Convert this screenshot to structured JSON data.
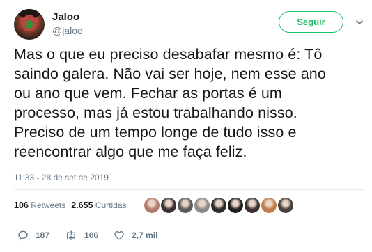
{
  "author": {
    "display_name": "Jaloo",
    "handle": "@jaloo"
  },
  "follow_button": {
    "label": "Seguir",
    "color": "#17bf63"
  },
  "tweet": {
    "text": "Mas o que eu preciso desabafar mesmo é: Tô\nsaindo galera. Não vai ser hoje, nem esse ano\nou ano que vem. Fechar as portas é um\nprocesso, mas já estou trabalhando nisso.\nPreciso de um tempo longe de tudo isso e\nreencontrar algo que me faça feliz.",
    "timestamp": "11:33 - 28 de set de 2019"
  },
  "stats": {
    "retweets_count": "106",
    "retweets_label": "Retweets",
    "likes_count": "2.655",
    "likes_label": "Curtidas",
    "liker_avatar_colors": [
      "#b07a6a",
      "#3a3030",
      "#5a5a5a",
      "#8a8a8a",
      "#2a2a2a",
      "#1e1e1e",
      "#3a2e2e",
      "#c07a4a",
      "#4a4040"
    ]
  },
  "actions": {
    "reply_icon": "reply-icon",
    "reply_count": "187",
    "retweet_icon": "retweet-icon",
    "retweet_count": "106",
    "like_icon": "heart-icon",
    "like_count": "2,7 mil"
  },
  "colors": {
    "text_primary": "#14171a",
    "text_secondary": "#657786",
    "divider": "#e6ecf0"
  }
}
